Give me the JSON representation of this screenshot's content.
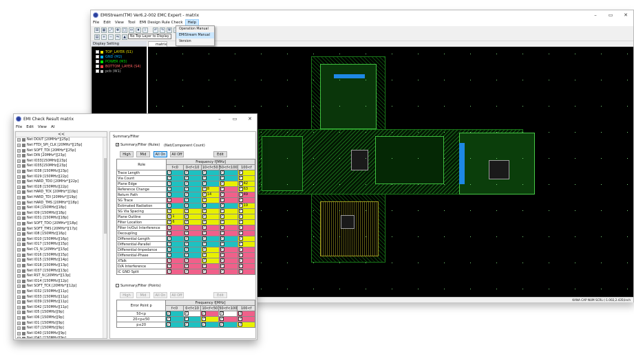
{
  "main_window": {
    "title": "EMIStream(TM) Ver6.2-002 EMC Expert - matrix",
    "menu": [
      "File",
      "Edit",
      "View",
      "Tool",
      "EMI Design Rule Check",
      "Help"
    ],
    "help_menu": [
      "Operation Manual",
      "EMIStream Manual",
      "Version"
    ],
    "tooltip": "No Top Layer to Display",
    "display_setting_title": "Display Setting",
    "layers": [
      {
        "label": "TOP_LAYER (S1)",
        "color": "#e8e000"
      },
      {
        "label": "GND (M2)",
        "color": "#00b0ff"
      },
      {
        "label": "POWER (M3)",
        "color": "#00e000"
      },
      {
        "label": "BOTTOM_LAYER (S4)",
        "color": "#ff4040"
      },
      {
        "label": "pcb (W1)",
        "color": "#bbbbbb"
      }
    ],
    "canvas_tab": "matrix",
    "status": "KANA  CAP  NUM  SCRL  (-1.002,2.435)inch"
  },
  "emi_window": {
    "title": "EMI Check Result matrix",
    "menu": [
      "File",
      "Edit",
      "View",
      "AI"
    ],
    "collapse_label": "<<",
    "nets": [
      "Net DOUT [20MHz*][25p]",
      "Net FTDI_SPI_CLK [20MHz*][25p]",
      "Net SOFT_TDI [20MHz*][25p]",
      "Net DIN [20MHz*][23p]",
      "Net IO33[150MHz][23p]",
      "Net IO35[150MHz][23p]",
      "Net IO38 [150MHz][23p]",
      "Net IO29 [150MHz][22p]",
      "Net HARD_TDO [20MHz*][22p]",
      "Net IO28 [150MHz][22p]",
      "Net HARD_TCK [20MHz*][19p]",
      "Net HARD_TDI [20MHz*][19p]",
      "Net HARD_TMS [20MHz*][18p]",
      "Net IO4 [150MHz][18p]",
      "Net IO9 [150MHz][18p]",
      "Net IO31 [150MHz][18p]",
      "Net SOFT_TDO [20MHz*][18p]",
      "Net SOFT_TMS [20MHz*][17p]",
      "Net IO8 [150MHz][16p]",
      "Net IO10 [150MHz][16p]",
      "Net IO17 [150MHz][15p]",
      "Net CS_N [20MHz*][15p]",
      "Net IO16 [150MHz][15p]",
      "Net IO15 [150MHz][14p]",
      "Net IO18 [150MHz][13p]",
      "Net IO37 [150MHz][13p]",
      "Net RST_N [20MHz*][13p]",
      "Net IO14 [150MHz][12p]",
      "Net SOFT_TCK [20MHz*][12p]",
      "Net IO32 [150MHz][11p]",
      "Net IO33 [150MHz][11p]",
      "Net IO39 [150MHz][11p]",
      "Net IO42 [150MHz][11p]",
      "Net IO5 [150MHz][9p]",
      "Net IO6 [150MHz][9p]",
      "Net IO1 [150MHz][9p]",
      "Net IO7 [150MHz][9p]",
      "Net IO40 [150MHz][9p]",
      "Net IO41 [150MHz][9p]"
    ],
    "summary_panel_title": "Summary/Filter",
    "rules": {
      "checkbox_label": "Summary/Filter (Rules)",
      "count_label": "(Net/Component Count)",
      "buttons": [
        "High",
        "Mid",
        "All On",
        "All Off"
      ],
      "edit": "Edit",
      "freq_header": "Frequency f[MHz]",
      "role_header": "Role",
      "columns": [
        "f<0",
        "0<f<10",
        "10<f<50",
        "50<f<100",
        "100<f"
      ],
      "rows": [
        {
          "name": "Trace Length",
          "cells": [
            [
              "C",
              ""
            ],
            [
              "C",
              ""
            ],
            [
              "C",
              ""
            ],
            [
              "C",
              ""
            ],
            [
              "Y",
              ""
            ]
          ]
        },
        {
          "name": "Via Count",
          "cells": [
            [
              "C",
              ""
            ],
            [
              "C",
              ""
            ],
            [
              "C",
              ""
            ],
            [
              "C",
              ""
            ],
            [
              "Y",
              ""
            ]
          ]
        },
        {
          "name": "Plane Edge",
          "cells": [
            [
              "C",
              ""
            ],
            [
              "C",
              ""
            ],
            [
              "C",
              ""
            ],
            [
              "Y",
              ""
            ],
            [
              "Y",
              "42"
            ]
          ]
        },
        {
          "name": "Reference Change",
          "cells": [
            [
              "C",
              ""
            ],
            [
              "C",
              ""
            ],
            [
              "Y",
              "8"
            ],
            [
              "R",
              ""
            ],
            [
              "Y",
              "63"
            ]
          ]
        },
        {
          "name": "Return Path",
          "cells": [
            [
              "C",
              ""
            ],
            [
              "C",
              ""
            ],
            [
              "Y",
              "14"
            ],
            [
              "R",
              ""
            ],
            [
              "R",
              "49"
            ]
          ]
        },
        {
          "name": "SG Trace",
          "cells": [
            [
              "R",
              ""
            ],
            [
              "C",
              ""
            ],
            [
              "Y",
              ""
            ],
            [
              "R",
              ""
            ],
            [
              "R",
              ""
            ]
          ]
        },
        {
          "name": "Estimated Radiation",
          "cells": [
            [
              "C",
              ""
            ],
            [
              "C",
              ""
            ],
            [
              "C",
              ""
            ],
            [
              "C",
              ""
            ],
            [
              "Y",
              "19"
            ]
          ]
        },
        {
          "name": "SG Via Spacing",
          "cells": [
            [
              "Y",
              ""
            ],
            [
              "Y",
              ""
            ],
            [
              "Y",
              ""
            ],
            [
              "Y",
              ""
            ],
            [
              "Y",
              ""
            ]
          ]
        },
        {
          "name": "Plane Outline",
          "cells": [
            [
              "Y",
              "1"
            ],
            [
              "Y",
              ""
            ],
            [
              "Y",
              ""
            ],
            [
              "Y",
              ""
            ],
            [
              "Y",
              ""
            ]
          ]
        },
        {
          "name": "Filter Location",
          "cells": [
            [
              "Y",
              "6"
            ],
            [
              "Y",
              ""
            ],
            [
              "Y",
              ""
            ],
            [
              "Y",
              ""
            ],
            [
              "Y",
              ""
            ]
          ]
        },
        {
          "name": "Filter In/Out Interference",
          "cells": [
            [
              "R",
              ""
            ],
            [
              "R",
              ""
            ],
            [
              "R",
              ""
            ],
            [
              "R",
              ""
            ],
            [
              "R",
              ""
            ]
          ]
        },
        {
          "name": "Decoupling",
          "cells": [
            [
              "R",
              ""
            ],
            [
              "R",
              ""
            ],
            [
              "R",
              ""
            ],
            [
              "R",
              ""
            ],
            [
              "R",
              ""
            ]
          ]
        },
        {
          "name": "Differential-Length",
          "cells": [
            [
              "C",
              ""
            ],
            [
              "C",
              ""
            ],
            [
              "C",
              ""
            ],
            [
              "C",
              ""
            ],
            [
              "Y",
              ""
            ]
          ]
        },
        {
          "name": "Differential-Parallel",
          "cells": [
            [
              "C",
              ""
            ],
            [
              "C",
              ""
            ],
            [
              "C",
              ""
            ],
            [
              "C",
              ""
            ],
            [
              "Y",
              ""
            ]
          ]
        },
        {
          "name": "Differential-Impedance",
          "cells": [
            [
              "C",
              ""
            ],
            [
              "C",
              ""
            ],
            [
              "Y",
              ""
            ],
            [
              "R",
              ""
            ],
            [
              "R",
              ""
            ]
          ]
        },
        {
          "name": "Differential-Phase",
          "cells": [
            [
              "C",
              ""
            ],
            [
              "C",
              ""
            ],
            [
              "Y",
              ""
            ],
            [
              "R",
              ""
            ],
            [
              "R",
              ""
            ]
          ]
        },
        {
          "name": "XTalk",
          "cells": [
            [
              "R",
              ""
            ],
            [
              "R",
              ""
            ],
            [
              "Y",
              ""
            ],
            [
              "R",
              ""
            ],
            [
              "R",
              ""
            ]
          ]
        },
        {
          "name": "D/A Interference",
          "cells": [
            [
              "R",
              ""
            ],
            [
              "R",
              ""
            ],
            [
              "R",
              ""
            ],
            [
              "R",
              ""
            ],
            [
              "R",
              ""
            ]
          ]
        },
        {
          "name": "IC GND Split",
          "cells": [
            [
              "R",
              ""
            ],
            [
              "R",
              ""
            ],
            [
              "R",
              ""
            ],
            [
              "R",
              ""
            ],
            [
              "R",
              ""
            ]
          ]
        }
      ]
    },
    "points": {
      "checkbox_label": "Summary/Filter (Points)",
      "buttons": [
        "High",
        "Mid",
        "All On",
        "All Off"
      ],
      "edit": "Edit",
      "freq_header": "Frequency f[MHz]",
      "role_header": "Error Point p",
      "columns": [
        "f<0",
        "0<f<10",
        "10<f<50",
        "50<f<100",
        "100<f"
      ],
      "rows": [
        {
          "name": "50<p",
          "cells": [
            [
              "C",
              ""
            ],
            [
              "W",
              ""
            ],
            [
              "R",
              ""
            ],
            [
              "W",
              ""
            ],
            [
              "R",
              ""
            ]
          ]
        },
        {
          "name": "20<p≤50",
          "cells": [
            [
              "C",
              ""
            ],
            [
              "C",
              ""
            ],
            [
              "Y",
              ""
            ],
            [
              "R",
              ""
            ],
            [
              "R",
              ""
            ]
          ]
        },
        {
          "name": "p≤20",
          "cells": [
            [
              "C",
              ""
            ],
            [
              "C",
              ""
            ],
            [
              "C",
              ""
            ],
            [
              "C",
              ""
            ],
            [
              "Y",
              ""
            ]
          ]
        }
      ]
    }
  }
}
